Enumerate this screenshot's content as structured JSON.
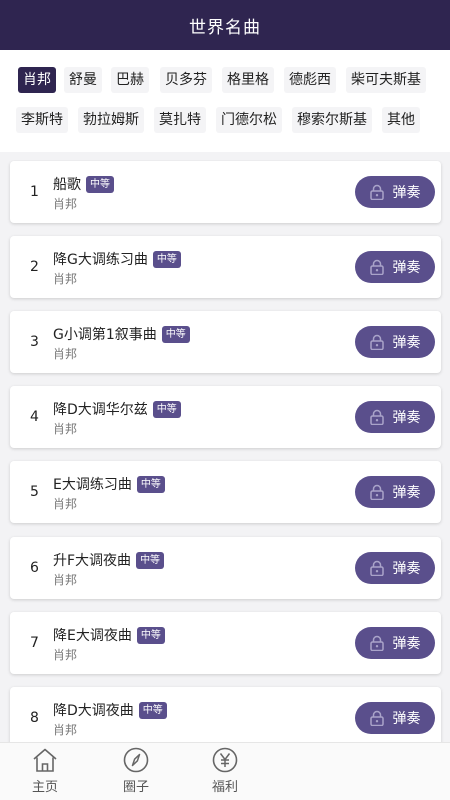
{
  "header": {
    "title": "世界名曲"
  },
  "composers": [
    {
      "label": "肖邦",
      "active": true
    },
    {
      "label": "舒曼",
      "active": false
    },
    {
      "label": "巴赫",
      "active": false
    },
    {
      "label": "贝多芬",
      "active": false
    },
    {
      "label": "格里格",
      "active": false
    },
    {
      "label": "德彪西",
      "active": false
    },
    {
      "label": "柴可夫斯基",
      "active": false
    },
    {
      "label": "李斯特",
      "active": false
    },
    {
      "label": "勃拉姆斯",
      "active": false
    },
    {
      "label": "莫扎特",
      "active": false
    },
    {
      "label": "门德尔松",
      "active": false
    },
    {
      "label": "穆索尔斯基",
      "active": false
    },
    {
      "label": "其他",
      "active": false
    }
  ],
  "pieces": [
    {
      "index": "1",
      "title": "船歌",
      "level": "中等",
      "composer": "肖邦",
      "action": "弹奏"
    },
    {
      "index": "2",
      "title": "降G大调练习曲",
      "level": "中等",
      "composer": "肖邦",
      "action": "弹奏"
    },
    {
      "index": "3",
      "title": "G小调第1叙事曲",
      "level": "中等",
      "composer": "肖邦",
      "action": "弹奏"
    },
    {
      "index": "4",
      "title": "降D大调华尔兹",
      "level": "中等",
      "composer": "肖邦",
      "action": "弹奏"
    },
    {
      "index": "5",
      "title": "E大调练习曲",
      "level": "中等",
      "composer": "肖邦",
      "action": "弹奏"
    },
    {
      "index": "6",
      "title": "升F大调夜曲",
      "level": "中等",
      "composer": "肖邦",
      "action": "弹奏"
    },
    {
      "index": "7",
      "title": "降E大调夜曲",
      "level": "中等",
      "composer": "肖邦",
      "action": "弹奏"
    },
    {
      "index": "8",
      "title": "降D大调夜曲",
      "level": "中等",
      "composer": "肖邦",
      "action": "弹奏"
    }
  ],
  "tabbar": {
    "items": [
      {
        "label": "主页",
        "icon": "home-icon"
      },
      {
        "label": "圈子",
        "icon": "compass-icon"
      },
      {
        "label": "福利",
        "icon": "yen-icon"
      }
    ]
  },
  "colors": {
    "header": "#2f2550",
    "accent": "#5a4f8c",
    "background": "#f3f3f5"
  }
}
